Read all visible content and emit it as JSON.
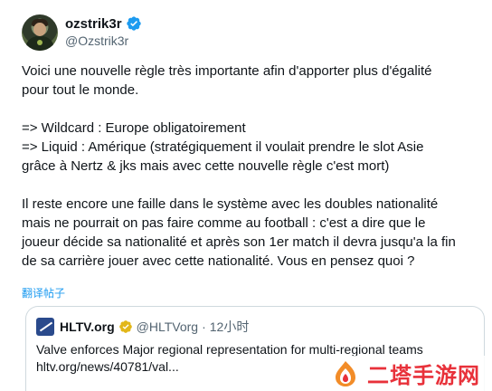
{
  "author": {
    "display_name": "ozstrik3r",
    "handle": "@Ozstrik3r",
    "verified_icon": "verified-badge-icon",
    "accent": "#1d9bf0"
  },
  "tweet": {
    "text": "Voici une nouvelle règle très importante afin d'apporter plus d'égalité\npour tout le monde.\n\n=> Wildcard : Europe obligatoirement\n=> Liquid : Amérique (stratégiquement il voulait prendre le slot Asie\ngrâce à Nertz & jks mais avec cette nouvelle règle c'est mort)\n\nIl reste encore une faille dans le système avec les doubles nationalité\nmais ne pourrait on pas faire comme au football : c'est a dire que le\njoueur décide sa nationalité et après son 1er match il devra jusqu'a la fin\nde sa carrière jouer avec cette nationalité. Vous en pensez quoi ?",
    "translate_label": "翻译帖子"
  },
  "quote": {
    "name": "HLTV.org",
    "handle": "@HLTVorg",
    "separator": "·",
    "time": "12小时",
    "line1": "Valve enforces Major regional representation for multi-regional teams",
    "line2": "hltv.org/news/40781/val..."
  },
  "watermark": {
    "text": "二塔手游网",
    "color": "#e8313a"
  }
}
